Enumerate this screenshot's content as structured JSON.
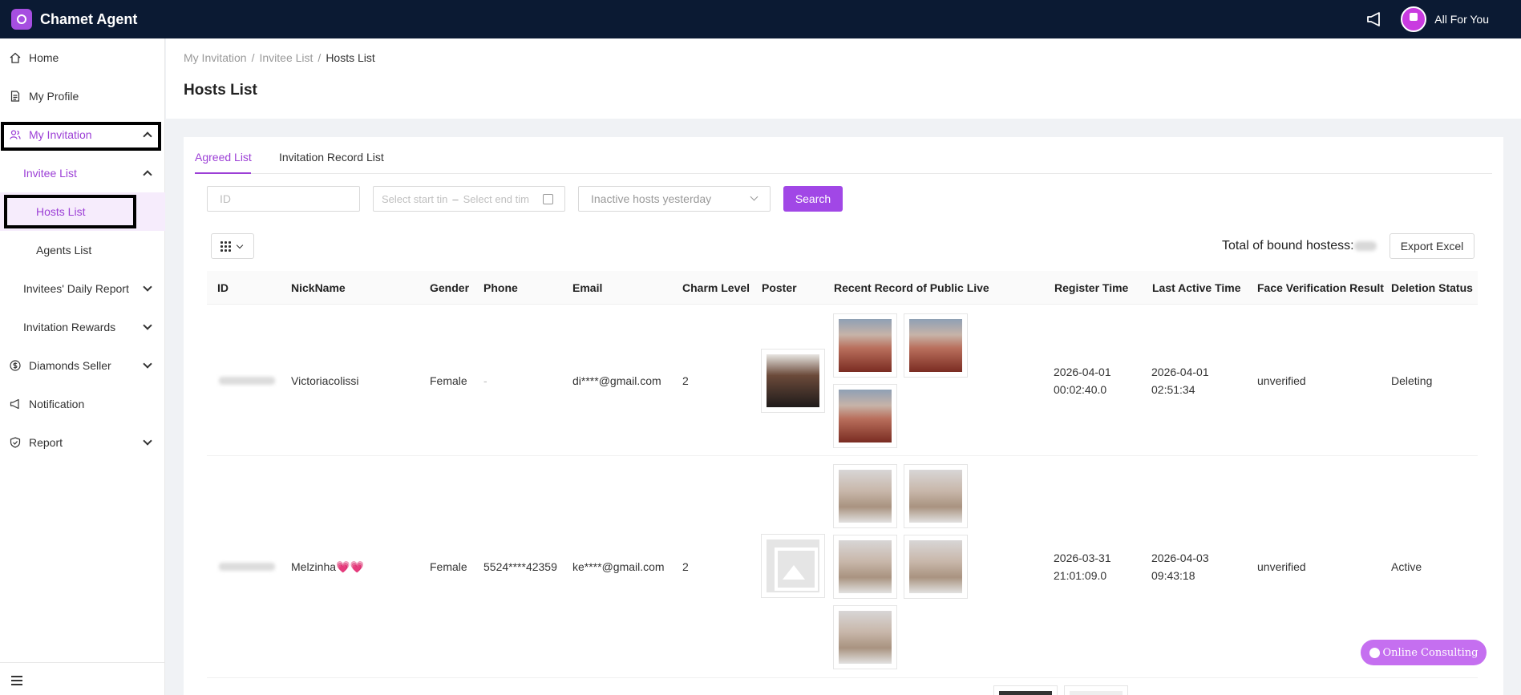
{
  "app": {
    "title": "Chamet Agent",
    "user_name": "All For You"
  },
  "sidebar": {
    "items": [
      {
        "label": "Home",
        "icon": "home-icon"
      },
      {
        "label": "My Profile",
        "icon": "file-icon"
      },
      {
        "label": "My Invitation",
        "icon": "users-icon"
      },
      {
        "label": "Invitee List"
      },
      {
        "label": "Hosts List"
      },
      {
        "label": "Agents List"
      },
      {
        "label": "Invitees' Daily Report"
      },
      {
        "label": "Invitation Rewards"
      },
      {
        "label": "Diamonds Seller",
        "icon": "dollar-icon"
      },
      {
        "label": "Notification",
        "icon": "megaphone-icon"
      },
      {
        "label": "Report",
        "icon": "shield-icon"
      }
    ]
  },
  "breadcrumb": {
    "items": [
      "My Invitation",
      "Invitee List",
      "Hosts List"
    ],
    "separator": "/"
  },
  "page_title": "Hosts List",
  "tabs": [
    "Agreed List",
    "Invitation Record List"
  ],
  "filters": {
    "id_placeholder": "ID",
    "start_placeholder": "Select start tin",
    "range_sep": "–",
    "end_placeholder": "Select end tim",
    "select_value": "Inactive hosts yesterday",
    "search_label": "Search"
  },
  "toolbar": {
    "total_label": "Total of bound hostess:",
    "export_label": "Export Excel"
  },
  "table": {
    "columns": [
      "ID",
      "NickName",
      "Gender",
      "Phone",
      "Email",
      "Charm Level",
      "Poster",
      "Recent Record of Public Live",
      "Register Time",
      "Last Active Time",
      "Face Verification Result",
      "Deletion Status"
    ],
    "rows": [
      {
        "nickname": "Victoriacolissi",
        "gender": "Female",
        "phone": "-",
        "email": "di****@gmail.com",
        "charm": "2",
        "register_date": "2026-04-01",
        "register_time": "00:02:40.0",
        "active_date": "2026-04-01",
        "active_time": "02:51:34",
        "face": "unverified",
        "deletion": "Deleting"
      },
      {
        "nickname": "Melzinha💗💗",
        "gender": "Female",
        "phone": "5524****42359",
        "email": "ke****@gmail.com",
        "charm": "2",
        "register_date": "2026-03-31",
        "register_time": "21:01:09.0",
        "active_date": "2026-04-03",
        "active_time": "09:43:18",
        "face": "unverified",
        "deletion": "Active"
      }
    ]
  },
  "consult_label": "Online Consulting",
  "colors": {
    "accent": "#9c3fd6",
    "topbar": "#0b1a33",
    "button": "#a147e6"
  }
}
